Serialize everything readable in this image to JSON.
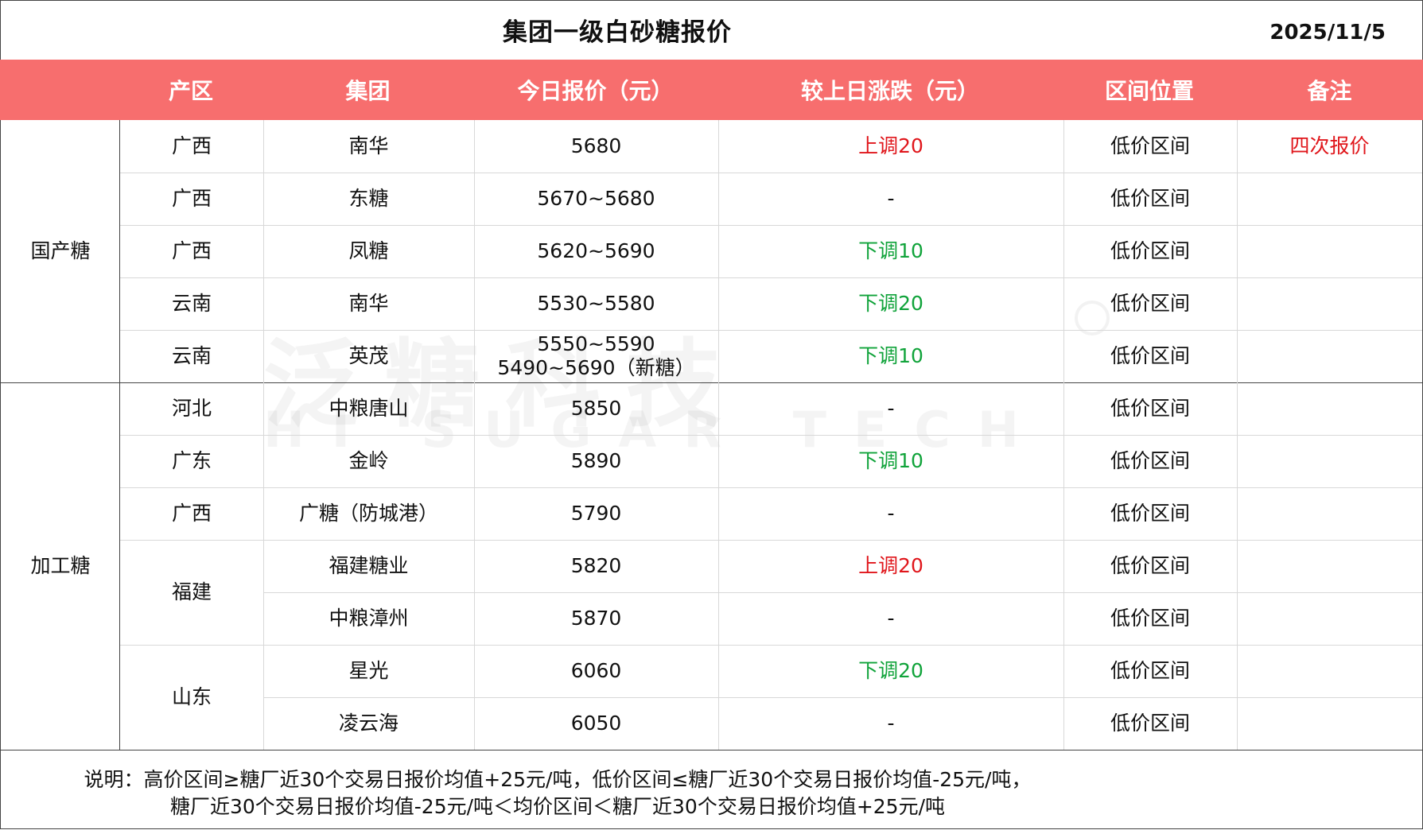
{
  "title": "集团一级白砂糖报价",
  "date": "2025/11/5",
  "colors": {
    "header_bg": "#f76e6e",
    "up": "#e0161b",
    "down": "#10a33a"
  },
  "headers": [
    "产区",
    "集团",
    "今日报价（元）",
    "较上日涨跌（元）",
    "区间位置",
    "备注"
  ],
  "sections": [
    "国产糖",
    "加工糖"
  ],
  "rows": [
    {
      "region": "广西",
      "group": "南华",
      "price": "5680",
      "change": "上调20",
      "position": "低价区间",
      "remark": "四次报价"
    },
    {
      "region": "广西",
      "group": "东糖",
      "price": "5670~5680",
      "change": "-",
      "position": "低价区间",
      "remark": ""
    },
    {
      "region": "广西",
      "group": "凤糖",
      "price": "5620~5690",
      "change": "下调10",
      "position": "低价区间",
      "remark": ""
    },
    {
      "region": "云南",
      "group": "南华",
      "price": "5530~5580",
      "change": "下调20",
      "position": "低价区间",
      "remark": ""
    },
    {
      "region": "云南",
      "group": "英茂",
      "price": "5550~5590",
      "price2": "5490~5690（新糖）",
      "change": "下调10",
      "position": "低价区间",
      "remark": ""
    },
    {
      "region": "河北",
      "group": "中粮唐山",
      "price": "5850",
      "change": "-",
      "position": "低价区间",
      "remark": ""
    },
    {
      "region": "广东",
      "group": "金岭",
      "price": "5890",
      "change": "下调10",
      "position": "低价区间",
      "remark": ""
    },
    {
      "region": "广西",
      "group": "广糖（防城港）",
      "price": "5790",
      "change": "-",
      "position": "低价区间",
      "remark": ""
    },
    {
      "region": "福建",
      "group": "福建糖业",
      "price": "5820",
      "change": "上调20",
      "position": "低价区间",
      "remark": ""
    },
    {
      "region": "",
      "group": "中粮漳州",
      "price": "5870",
      "change": "-",
      "position": "低价区间",
      "remark": ""
    },
    {
      "region": "山东",
      "group": "星光",
      "price": "6060",
      "change": "下调20",
      "position": "低价区间",
      "remark": ""
    },
    {
      "region": "",
      "group": "凌云海",
      "price": "6050",
      "change": "-",
      "position": "低价区间",
      "remark": ""
    }
  ],
  "watermark": {
    "cn": "泛糖科技",
    "en": "HI SUGAR TECH"
  },
  "note": {
    "line1": "说明：高价区间≥糖厂近30个交易日报价均值+25元/吨，低价区间≤糖厂近30个交易日报价均值-25元/吨，",
    "line2": "糖厂近30个交易日报价均值-25元/吨＜均价区间＜糖厂近30个交易日报价均值+25元/吨"
  }
}
